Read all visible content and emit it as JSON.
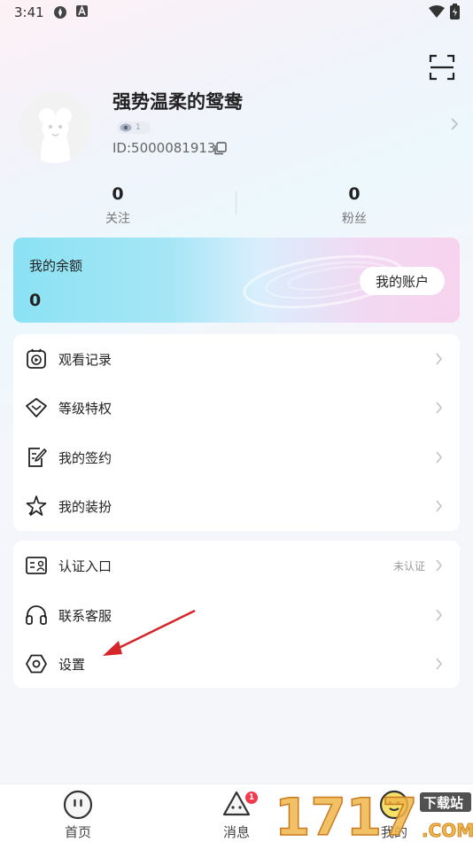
{
  "status_bar": {
    "time": "3:41"
  },
  "profile": {
    "nickname": "强势温柔的鸳鸯",
    "level": "1",
    "user_id": "ID:5000081913"
  },
  "stats": [
    {
      "value": "0",
      "label": "关注"
    },
    {
      "value": "0",
      "label": "粉丝"
    }
  ],
  "balance": {
    "title": "我的余额",
    "amount": "0",
    "account_button": "我的账户"
  },
  "menu_group_1": [
    {
      "label": "观看记录",
      "icon": "watch-history-icon"
    },
    {
      "label": "等级特权",
      "icon": "diamond-icon"
    },
    {
      "label": "我的签约",
      "icon": "sign-contract-icon"
    },
    {
      "label": "我的装扮",
      "icon": "star-icon"
    }
  ],
  "menu_group_2": [
    {
      "label": "认证入口",
      "icon": "id-card-icon",
      "status": "未认证"
    },
    {
      "label": "联系客服",
      "icon": "headphones-icon"
    },
    {
      "label": "设置",
      "icon": "settings-icon"
    }
  ],
  "tabbar": [
    {
      "label": "首页",
      "icon": "home-icon"
    },
    {
      "label": "消息",
      "icon": "message-icon",
      "badge": "1"
    },
    {
      "label": "我的",
      "icon": "profile-icon"
    }
  ],
  "watermark": {
    "text": "1717",
    "site": "下载站",
    "domain": ".COM"
  },
  "colors": {
    "accent_red": "#d6242b",
    "badge_red": "#f23a4c"
  }
}
